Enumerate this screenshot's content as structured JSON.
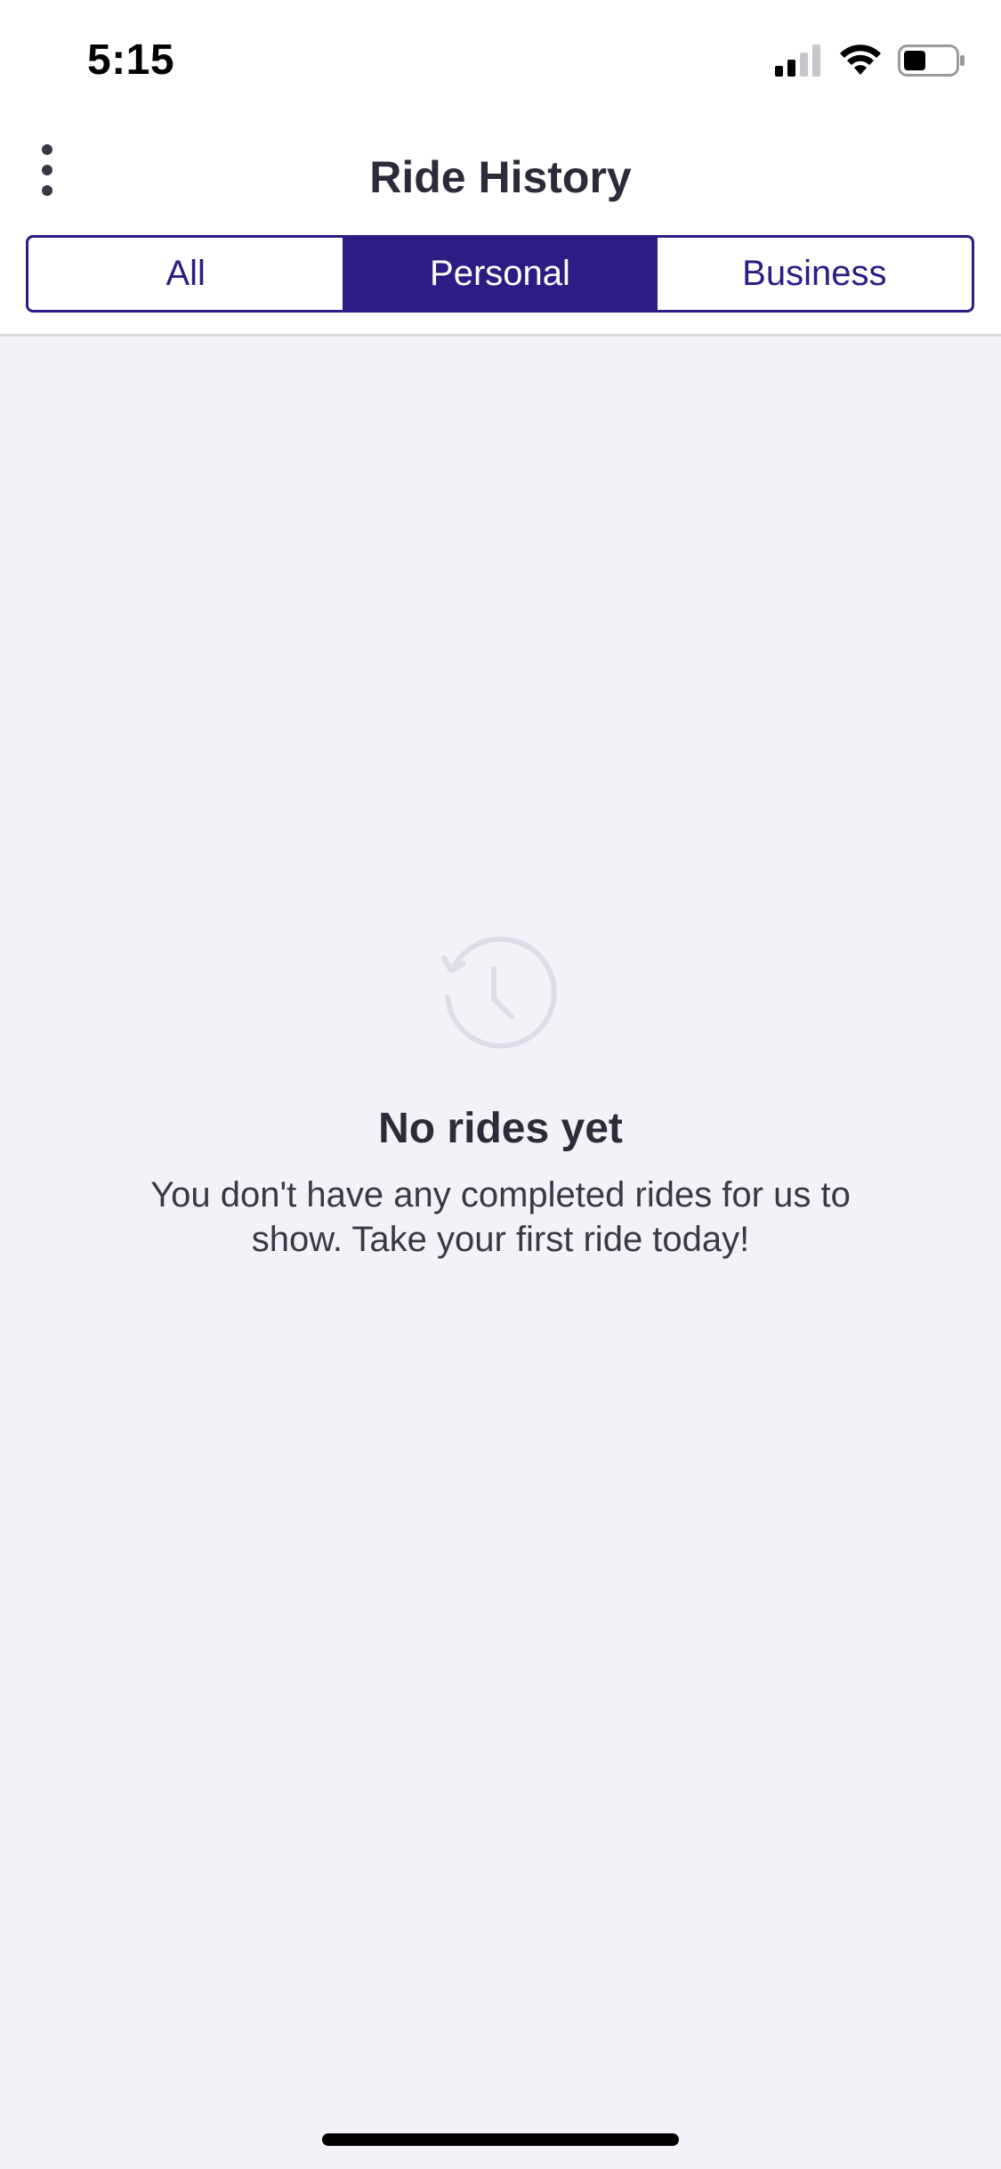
{
  "status_bar": {
    "time": "5:15"
  },
  "header": {
    "title": "Ride History",
    "menu_icon": "more-vertical-icon"
  },
  "tabs": [
    {
      "label": "All",
      "active": false
    },
    {
      "label": "Personal",
      "active": true
    },
    {
      "label": "Business",
      "active": false
    }
  ],
  "empty_state": {
    "icon": "history-icon",
    "title": "No rides yet",
    "message": "You don't have any completed rides for us to show. Take your first ride today!"
  },
  "colors": {
    "accent": "#2c1d85",
    "background": "#f2f3f8",
    "header_background": "#ffffff",
    "icon_muted": "#dcdde6"
  }
}
